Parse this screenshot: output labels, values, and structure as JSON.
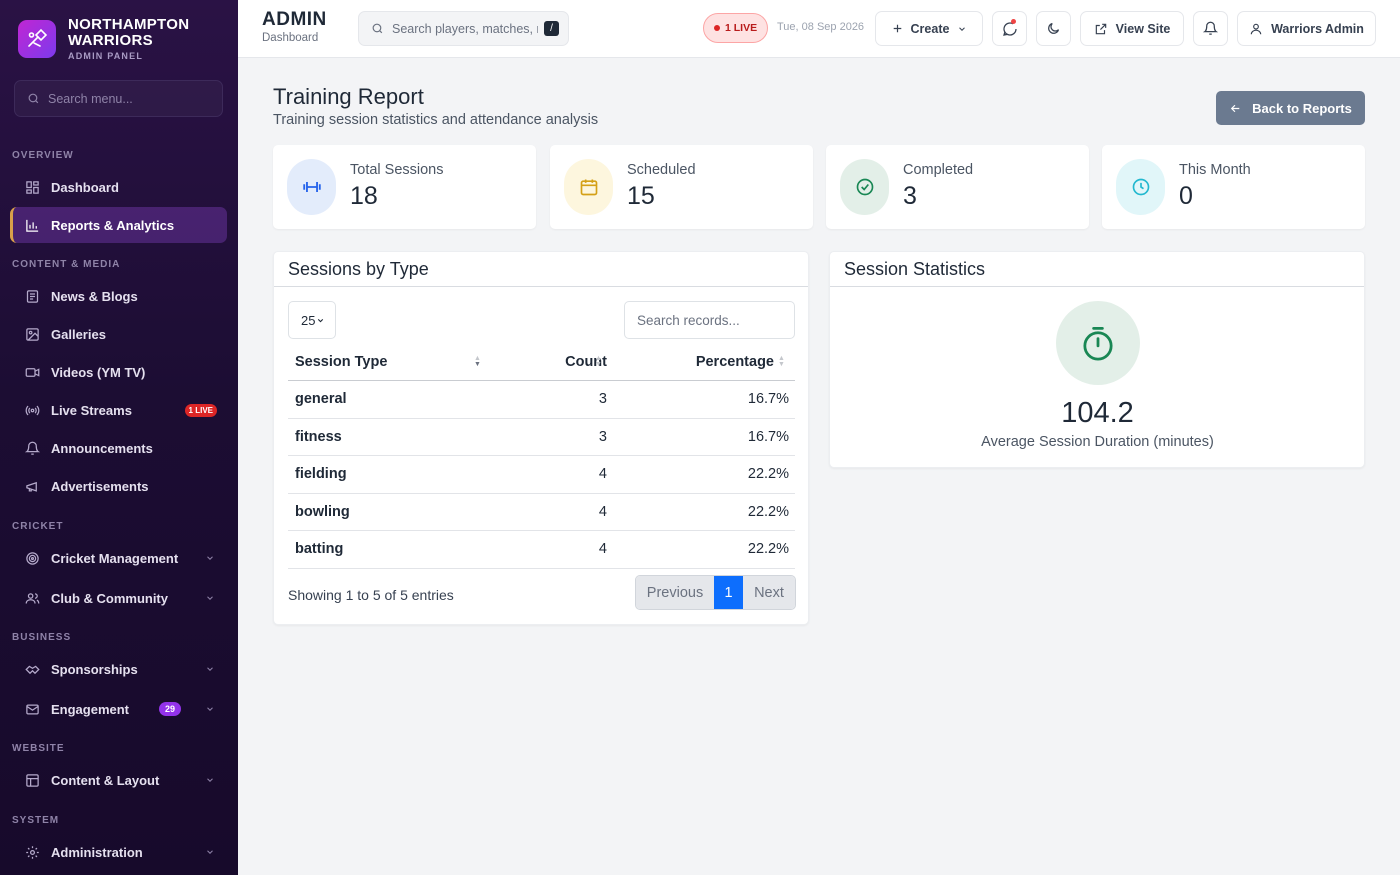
{
  "brand": {
    "name_line1": "NORTHAMPTON",
    "name_line2": "WARRIORS",
    "subtitle": "ADMIN PANEL"
  },
  "sidebar": {
    "search_placeholder": "Search menu...",
    "sections": {
      "overview": "OVERVIEW",
      "content_media": "CONTENT & MEDIA",
      "cricket": "CRICKET",
      "business": "BUSINESS",
      "website": "WEBSITE",
      "system": "SYSTEM"
    },
    "items": {
      "dashboard": "Dashboard",
      "reports": "Reports & Analytics",
      "news": "News & Blogs",
      "galleries": "Galleries",
      "videos": "Videos (YM TV)",
      "live_streams": "Live Streams",
      "live_badge": "1 LIVE",
      "announcements": "Announcements",
      "advertisements": "Advertisements",
      "cricket_mgmt": "Cricket Management",
      "club_community": "Club & Community",
      "sponsorships": "Sponsorships",
      "engagement": "Engagement",
      "engagement_badge": "29",
      "content_layout": "Content & Layout",
      "administration": "Administration"
    }
  },
  "topbar": {
    "title": "ADMIN",
    "subtitle": "Dashboard",
    "search_placeholder": "Search players, matches, r",
    "search_shortcut": "/",
    "live_label": "1 LIVE",
    "date": "Tue, 08 Sep 2026",
    "create_label": "Create",
    "view_site_label": "View Site",
    "user_label": "Warriors Admin"
  },
  "page": {
    "title": "Training Report",
    "subtitle": "Training session statistics and attendance analysis",
    "back_label": "Back to Reports"
  },
  "stats": [
    {
      "label": "Total Sessions",
      "value": "18",
      "color": "#2563eb",
      "bg": "#e3ecfb",
      "icon": "dumbbell-icon"
    },
    {
      "label": "Scheduled",
      "value": "15",
      "color": "#d4a017",
      "bg": "#fdf6de",
      "icon": "calendar-icon"
    },
    {
      "label": "Completed",
      "value": "3",
      "color": "#198754",
      "bg": "#e3efe8",
      "icon": "check-circle-icon"
    },
    {
      "label": "This Month",
      "value": "0",
      "color": "#22b8cf",
      "bg": "#e1f6f9",
      "icon": "clock-icon"
    }
  ],
  "sessions_table": {
    "title": "Sessions by Type",
    "page_length": "25",
    "search_placeholder": "Search records...",
    "columns": [
      "Session Type",
      "Count",
      "Percentage"
    ],
    "rows": [
      {
        "type": "general",
        "count": "3",
        "percentage": "16.7%"
      },
      {
        "type": "fitness",
        "count": "3",
        "percentage": "16.7%"
      },
      {
        "type": "fielding",
        "count": "4",
        "percentage": "22.2%"
      },
      {
        "type": "bowling",
        "count": "4",
        "percentage": "22.2%"
      },
      {
        "type": "batting",
        "count": "4",
        "percentage": "22.2%"
      }
    ],
    "info": "Showing 1 to 5 of 5 entries",
    "pager": {
      "previous": "Previous",
      "current": "1",
      "next": "Next"
    }
  },
  "session_stats": {
    "title": "Session Statistics",
    "value": "104.2",
    "label": "Average Session Duration (minutes)",
    "icon": "stopwatch-icon"
  }
}
